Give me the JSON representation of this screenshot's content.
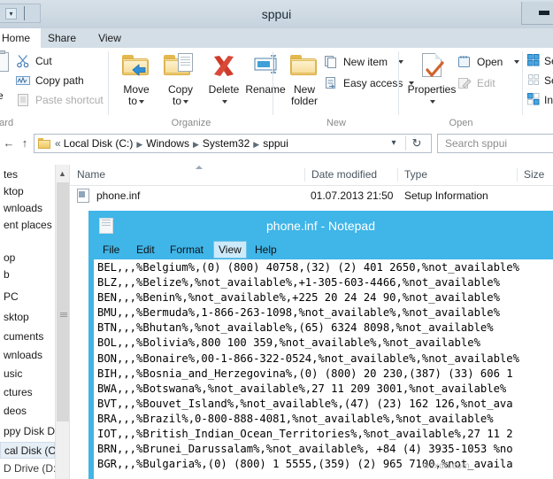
{
  "window": {
    "title": "sppui",
    "quick_access_icon": "quick-access-chevron-icon",
    "minimize_label": "–"
  },
  "tabs": [
    {
      "id": "home",
      "label": "Home",
      "active": true
    },
    {
      "id": "share",
      "label": "Share",
      "active": false
    },
    {
      "id": "view",
      "label": "View",
      "active": false
    }
  ],
  "ribbon": {
    "groups": [
      {
        "id": "clipboard",
        "label": "Clipboard"
      },
      {
        "id": "organize",
        "label": "Organize"
      },
      {
        "id": "new",
        "label": "New"
      },
      {
        "id": "open",
        "label": "Open"
      }
    ],
    "clipboard": {
      "paste_partial": "ce",
      "cut": "Cut",
      "copy_path": "Copy path",
      "paste_shortcut": "Paste shortcut"
    },
    "organize": {
      "move_to_line1": "Move",
      "move_to_line2": "to",
      "copy_to_line1": "Copy",
      "copy_to_line2": "to",
      "delete": "Delete",
      "rename": "Rename"
    },
    "new": {
      "new_folder_line1": "New",
      "new_folder_line2": "folder",
      "new_item": "New item",
      "easy_access": "Easy access"
    },
    "open": {
      "properties": "Properties",
      "open": "Open",
      "edit": "Edit"
    },
    "select": {
      "select_all_partial": "Se",
      "select_none_partial": "Se",
      "invert_partial": "In"
    }
  },
  "address": {
    "back_icon": "back-arrow-icon",
    "up_icon": "up-arrow-icon",
    "overflow": "«",
    "crumbs": [
      "Local Disk (C:)",
      "Windows",
      "System32",
      "sppui"
    ],
    "dropdown_icon": "chevron-down-icon",
    "refresh_icon": "refresh-icon",
    "search_placeholder": "Search sppui"
  },
  "nav_pane": {
    "items": [
      {
        "label": "tes",
        "selected": false
      },
      {
        "label": "ktop",
        "selected": false
      },
      {
        "label": "wnloads",
        "selected": false
      },
      {
        "label": "ent places",
        "selected": false
      },
      {
        "label": "op",
        "selected": false
      },
      {
        "label": "b",
        "selected": false
      },
      {
        "label": "PC",
        "selected": false
      },
      {
        "label": "sktop",
        "selected": false
      },
      {
        "label": "cuments",
        "selected": false
      },
      {
        "label": "wnloads",
        "selected": false
      },
      {
        "label": "usic",
        "selected": false
      },
      {
        "label": "ctures",
        "selected": false
      },
      {
        "label": "deos",
        "selected": false
      },
      {
        "label": "ppy Disk Dri",
        "selected": false
      },
      {
        "label": "cal Disk (C:)",
        "selected": true
      },
      {
        "label": "D Drive (D:)",
        "selected": false
      }
    ]
  },
  "file_list": {
    "columns": [
      {
        "key": "name",
        "label": "Name"
      },
      {
        "key": "date",
        "label": "Date modified"
      },
      {
        "key": "type",
        "label": "Type"
      },
      {
        "key": "size",
        "label": "Size"
      }
    ],
    "rows": [
      {
        "icon": "inf-file-icon",
        "name": "phone.inf",
        "date": "01.07.2013 21:50",
        "type": "Setup Information",
        "size": ""
      }
    ]
  },
  "notepad": {
    "title": "phone.inf - Notepad",
    "icon": "notepad-document-icon",
    "menu": [
      {
        "label": "File",
        "highlighted": false
      },
      {
        "label": "Edit",
        "highlighted": false
      },
      {
        "label": "Format",
        "highlighted": false
      },
      {
        "label": "View",
        "highlighted": true
      },
      {
        "label": "Help",
        "highlighted": false
      }
    ],
    "titlebar_color": "#3fb5e8",
    "content": "BEL,,,%Belgium%,(0) (800) 40758,(32) (2) 401 2650,%not_available%\nBLZ,,,%Belize%,%not_available%,+1-305-603-4466,%not_available%\nBEN,,,%Benin%,%not_available%,+225 20 24 24 90,%not_available%\nBMU,,,%Bermuda%,1-866-263-1098,%not_available%,%not_available%\nBTN,,,%Bhutan%,%not_available%,(65) 6324 8098,%not_available%\nBOL,,,%Bolivia%,800 100 359,%not_available%,%not_available%\nBON,,,%Bonaire%,00-1-866-322-0524,%not_available%,%not_available%\nBIH,,,%Bosnia_and_Herzegovina%,(0) (800) 20 230,(387) (33) 606 1\nBWA,,,%Botswana%,%not_available%,27 11 209 3001,%not_available%\nBVT,,,%Bouvet_Island%,%not_available%,(47) (23) 162 126,%not_ava\nBRA,,,%Brazil%,0-800-888-4081,%not_available%,%not_available%\nIOT,,,%British_Indian_Ocean_Territories%,%not_available%,27 11 2\nBRN,,,%Brunei_Darussalam%,%not_available%, +84 (4) 3935-1053 %no\nBGR,,,%Bulgaria%,(0) (800) 1 5555,(359) (2) 965 7100,%not_availa"
  },
  "watermark": {
    "text": "wsxdn.com"
  }
}
